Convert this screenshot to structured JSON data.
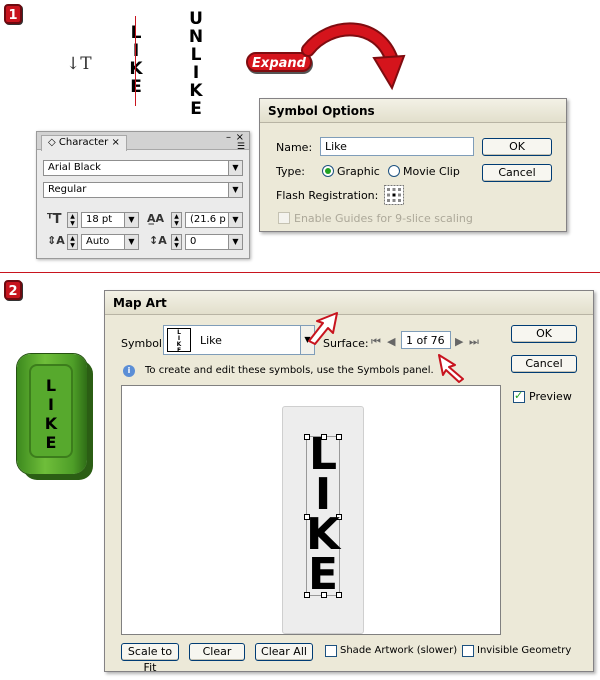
{
  "step1": {
    "badge": "1"
  },
  "step2": {
    "badge": "2"
  },
  "type_tool": {
    "icon": "vertical-type-tool-icon",
    "glyph": "↓T"
  },
  "like_word": [
    "L",
    "I",
    "K",
    "E"
  ],
  "unlike_word": [
    "U",
    "N",
    "L",
    "I",
    "K",
    "E"
  ],
  "expand_label": "Expand",
  "character_panel": {
    "tab_label": "Character",
    "close": "×",
    "font_family": "Arial Black",
    "font_style": "Regular",
    "font_size": "18 pt",
    "leading": "(21.6 p",
    "kerning": "Auto",
    "tracking": "0"
  },
  "symbol_options": {
    "title": "Symbol Options",
    "name_label": "Name:",
    "name_value": "Like",
    "type_label": "Type:",
    "type_graphic": "Graphic",
    "type_movie": "Movie Clip",
    "flash_registration_label": "Flash Registration:",
    "guides_label": "Enable Guides for 9-slice scaling",
    "ok": "OK",
    "cancel": "Cancel"
  },
  "map_art": {
    "title": "Map Art",
    "symbol_label": "Symbol:",
    "symbol_value": "Like",
    "surface_label": "Surface:",
    "surface_value": "1 of 76",
    "info_text": "To create and edit these symbols, use the Symbols panel.",
    "ok": "OK",
    "cancel": "Cancel",
    "preview_label": "Preview",
    "scale_to_fit": "Scale to Fit",
    "clear": "Clear",
    "clear_all": "Clear All",
    "shade_artwork": "Shade Artwork (slower)",
    "invisible_geometry": "Invisible Geometry",
    "preview_letters": [
      "L",
      "I",
      "K",
      "E"
    ]
  },
  "object3d_letters": [
    "L",
    "I",
    "K",
    "E"
  ],
  "colors": {
    "accent_red": "#c8141e",
    "green": "#57a92d"
  }
}
